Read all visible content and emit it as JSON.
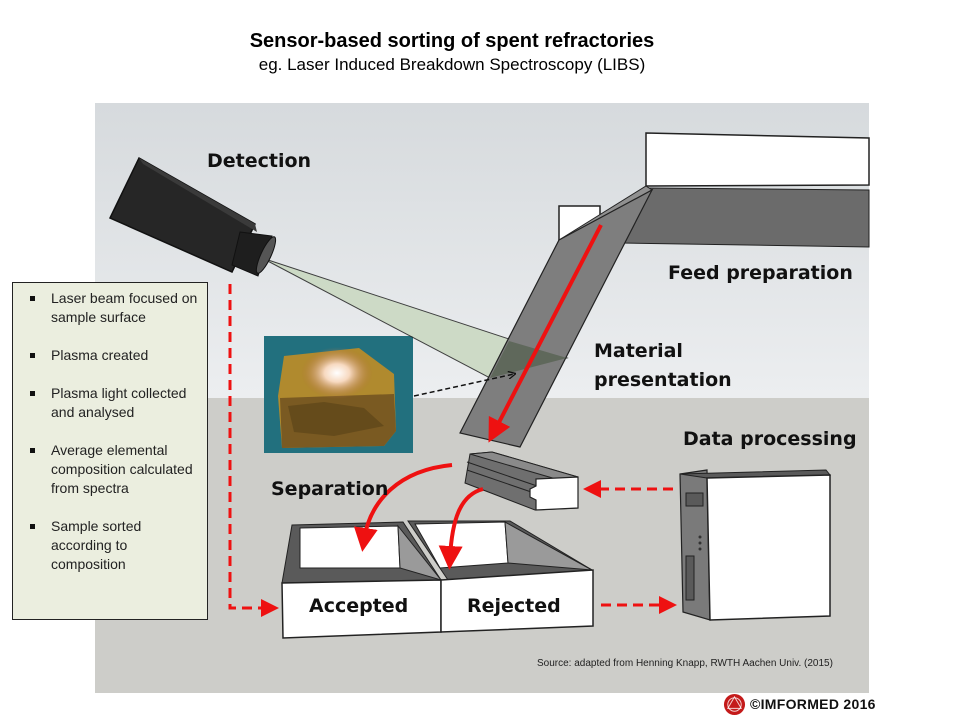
{
  "header": {
    "title": "Sensor-based sorting of spent refractories",
    "subtitle": "eg. Laser Induced Breakdown Spectroscopy (LIBS)"
  },
  "stages": {
    "detection": "Detection",
    "feed_preparation": "Feed preparation",
    "material_presentation_line1": "Material",
    "material_presentation_line2": "presentation",
    "data_processing": "Data processing",
    "separation": "Separation",
    "accepted": "Accepted",
    "rejected": "Rejected"
  },
  "info_box": {
    "items": [
      "Laser beam focused on sample surface",
      "Plasma created",
      "Plasma light collected and analysed",
      "Average elemental composition calculated from spectra",
      "Sample sorted according to composition"
    ]
  },
  "footer": {
    "source": "Source: adapted from Henning Knapp, RWTH  Aachen Univ. (2015)",
    "copyright": "©IMFORMED  2016"
  },
  "colors": {
    "flow_arrow": "#ee1111",
    "conveyor": "#7a7a7a",
    "beam": "#c9d8c0",
    "logo": "#c41a1a"
  },
  "icons": {
    "camera": "sensor-camera-icon",
    "logo": "imformed-logo-icon"
  }
}
